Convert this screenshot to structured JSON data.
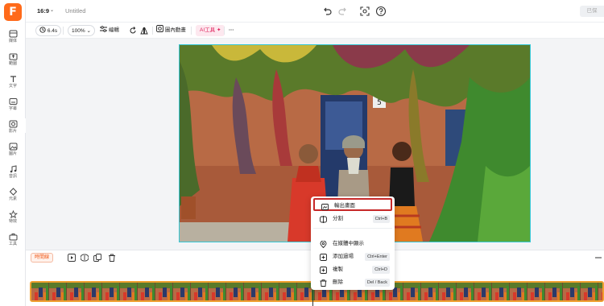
{
  "app": {
    "logo_letter": "F",
    "title": "Untitled",
    "aspect_ratio": "16:9",
    "export_label": "已保"
  },
  "sidebar": {
    "items": [
      {
        "label": "媒体",
        "icon": "media-icon"
      },
      {
        "label": "範圍",
        "icon": "upload-icon"
      },
      {
        "label": "文字",
        "icon": "text-icon"
      },
      {
        "label": "字幕",
        "icon": "subtitle-icon"
      },
      {
        "label": "影片",
        "icon": "video-icon"
      },
      {
        "label": "圖片",
        "icon": "image-icon"
      },
      {
        "label": "音訊",
        "icon": "music-icon"
      },
      {
        "label": "元素",
        "icon": "element-icon"
      },
      {
        "label": "特效",
        "icon": "effects-icon"
      },
      {
        "label": "工具",
        "icon": "tools-icon"
      }
    ]
  },
  "toolbar": {
    "duration": "6.4s",
    "zoom": "100%",
    "edit_label": "编輯",
    "crop_anim_label": "圖內動畫",
    "ai_label": "AI工具",
    "more_label": "···"
  },
  "timeline": {
    "tag_label": "時間線"
  },
  "context_menu": {
    "items": [
      {
        "label": "輸出畫面",
        "icon": "export-frame-icon",
        "shortcut": ""
      },
      {
        "label": "分割",
        "icon": "split-icon",
        "shortcut": "Ctrl+B"
      },
      {
        "label": "在媒體中顯示",
        "icon": "location-icon",
        "shortcut": ""
      },
      {
        "label": "添加過場",
        "icon": "add-transition-icon",
        "shortcut": "Ctrl+Enter"
      },
      {
        "label": "複製",
        "icon": "copy-icon",
        "shortcut": "Ctrl+D"
      },
      {
        "label": "刪除",
        "icon": "trash-icon",
        "shortcut": "Del / Back"
      }
    ]
  },
  "colors": {
    "brand": "#ff6a1a",
    "selection_border": "#36c8d6",
    "clip_border": "#f0a030",
    "menu_highlight": "#c62828"
  }
}
